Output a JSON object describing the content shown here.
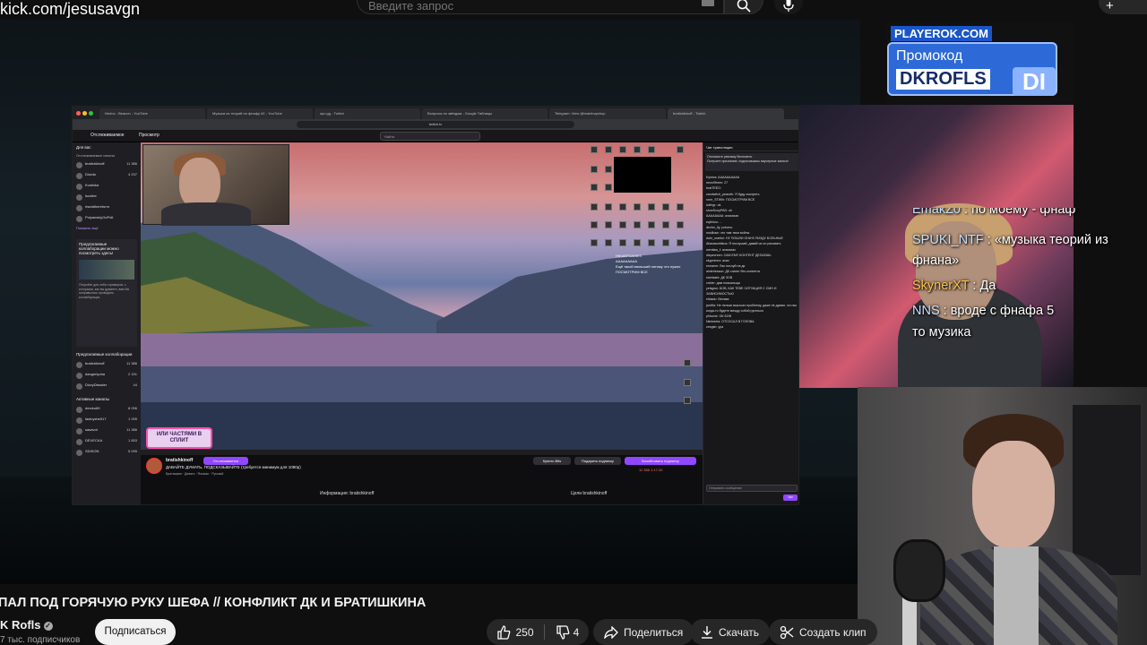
{
  "overlay": {
    "kick_url": "kick.com/jesusavgn"
  },
  "search": {
    "placeholder": "Введите запрос"
  },
  "header": {
    "create_label": "+"
  },
  "nested_browser": {
    "tabs": [
      "Nedov - Beacon - YouTube",
      "Музыка из теорий по фнафу #2 - YouTube",
      "spo.gg - Twitch",
      "Вопросы по звёздам - Google Таблицы",
      "Telegram: View @brainboyshop",
      "bratishkinoff - Twitch"
    ],
    "url": "twitch.tv",
    "nav": {
      "following": "Отслеживаемое",
      "browse": "Просмотр",
      "search": "Найти"
    },
    "sidebar": {
      "heading": "Для вас",
      "followed": "Отслеживаемые каналы",
      "channels": [
        {
          "name": "bratishkinoff",
          "count": "11 386"
        },
        {
          "name": "Diorda",
          "count": "4 237"
        },
        {
          "name": "Kvalinka",
          "count": ""
        },
        {
          "name": "lscutter",
          "count": ""
        },
        {
          "name": "riseatthereform",
          "count": ""
        },
        {
          "name": "PolyanskiyGoPolt",
          "count": ""
        }
      ],
      "show_more": "Показать ещё",
      "promo_title": "Предлагаемые коллаборации можно посмотреть здесь!",
      "promo_desc": "Откройте для себя стримеров, с которыми, как вы думаете, вам бы понравилось проводить коллаборации.",
      "suggested": "Предлагаемые коллаборации",
      "active": "Активные каналы",
      "active_channels": [
        {
          "name": "bratishkinoff",
          "count": "11 386"
        },
        {
          "name": "dangerlyoha",
          "count": "2 151"
        },
        {
          "name": "DizzyDissster",
          "count": "44"
        },
        {
          "name": "derzko69",
          "count": "8 096"
        },
        {
          "name": "lastnyshe517",
          "count": "1 095"
        },
        {
          "name": "sasavot",
          "count": "11 386"
        },
        {
          "name": "DEVECKA",
          "count": "1 853"
        },
        {
          "name": "SDISON",
          "count": "5 095"
        }
      ]
    },
    "player": {
      "promo_badge": "ИЛИ ЧАСТЯМИ В СПЛИТ",
      "mini_chat": [
        "HIKAEFGAMES",
        "AAAAAAAAA",
        "Ещё такой июльский потому что нужно",
        "ПОСМОТРИМ ВСЕ"
      ]
    },
    "stream_info": {
      "channel": "bratishkinoff",
      "follow": "Отслеживается",
      "title": "ДАВАЙТЕ ДУМАТЬ, ПОДСКАЗЫВАЙТЕ (требуется минимум для 1080р)",
      "tags": "Братишкин · Девять · Russian · Русский",
      "buy": "Купить Bits",
      "gift": "Подарить подписку",
      "subscribe": "Возобновить подписку",
      "viewers": "11 386  1:17:20",
      "about": "Информация: bratishkinoff",
      "goals": "Цели bratishkinoff"
    },
    "chat": {
      "header": "Чат трансляции",
      "ad": "Отключите рекламу бесплатно",
      "pinned": "Получите признание, подписавшись ваучерные записи!",
      "messages": [
        "Kylnics: AAAAAAAAAA",
        "neon0freen: 27",
        "bratTEEO:",
        "zandwitch_pearoth: Я буду смотреть",
        "rone_STWIh: ПОСМОТРИМ ВСЕ",
        "lclehgr: ok",
        "shoeDoxyPAD: ok",
        "AAAAAAAA: ахахахах",
        "eqibriuu: ...",
        "devfor_lly: potomu",
        "noslikaw: что там твои войны",
        "dobr_martini: НУ ПОШЛИ ОНИ В ПИЗДУ БОЛЬНЫЕ",
        "Ailanasvetlana: Я послушай, давай чи он рисовать",
        "wentiaw_f: ахахахах",
        "dispecreen: САМ ЕМУ КОНТЕНТ ДЕЛАЕШЬ",
        "skyprimez: ахах",
        "ennanm: Ляк послуй на дк",
        "ainterlesson: ДК сгинет без контента",
        "strellasht: ДК ЗОВ",
        "crizler: дам плакальщи",
        "yelsgwn: БОВ, КАК TEBE СИТУАЦИЯ С СМН И ЗАВИСИМОСТЬЮ",
        "ellasdu: Велика",
        "janWa: Не нельзя высосал проблему, даже не думал, что вы когда-то будете между собой ругаться",
        "pf4sche: ОК БОВ",
        "Nimbeela: ОТСОСАЛ В ГОЛОВА",
        "zesgsh: ура"
      ],
      "input_placeholder": "Отправить сообщение",
      "chat_button": "Чат"
    }
  },
  "promo": {
    "site": "PLAYEROK.COM",
    "label": "Промокод",
    "code": "DKROFLS",
    "logo": "DI"
  },
  "chat_overlay": [
    {
      "user": "EmakZ0",
      "text": " : по моему - фнаф"
    },
    {
      "user": "SPUKI_NTF",
      "text": " : «музыка теорий из"
    },
    {
      "user": "",
      "text": "фнана»"
    },
    {
      "user": "SkynerXT",
      "text": " : Да"
    },
    {
      "user": "NNS",
      "text": " : вроде с фнафа 5"
    },
    {
      "user": "",
      "text": "то музика"
    }
  ],
  "video": {
    "title": "ПАЛ ПОД ГОРЯЧУЮ РУКУ ШЕФА // КОНФЛИКТ ДК И БРАТИШКИНА",
    "channel": "K Rofls",
    "subscribers": "7 тыс. подписчиков",
    "subscribe": "Подписаться",
    "likes": "250",
    "dislikes": "4",
    "share": "Поделиться",
    "download": "Скачать",
    "clip": "Создать клип"
  },
  "colors": {
    "twitch_purple": "#9147ff",
    "yt_bg": "#0f0f0f",
    "pill_bg": "#272727",
    "promo_blue": "#2d6ad8"
  },
  "icons": [
    "search-icon",
    "mic-icon",
    "keyboard-icon",
    "thumb-up-icon",
    "thumb-down-icon",
    "share-icon",
    "download-icon",
    "scissors-icon",
    "verified-icon"
  ]
}
